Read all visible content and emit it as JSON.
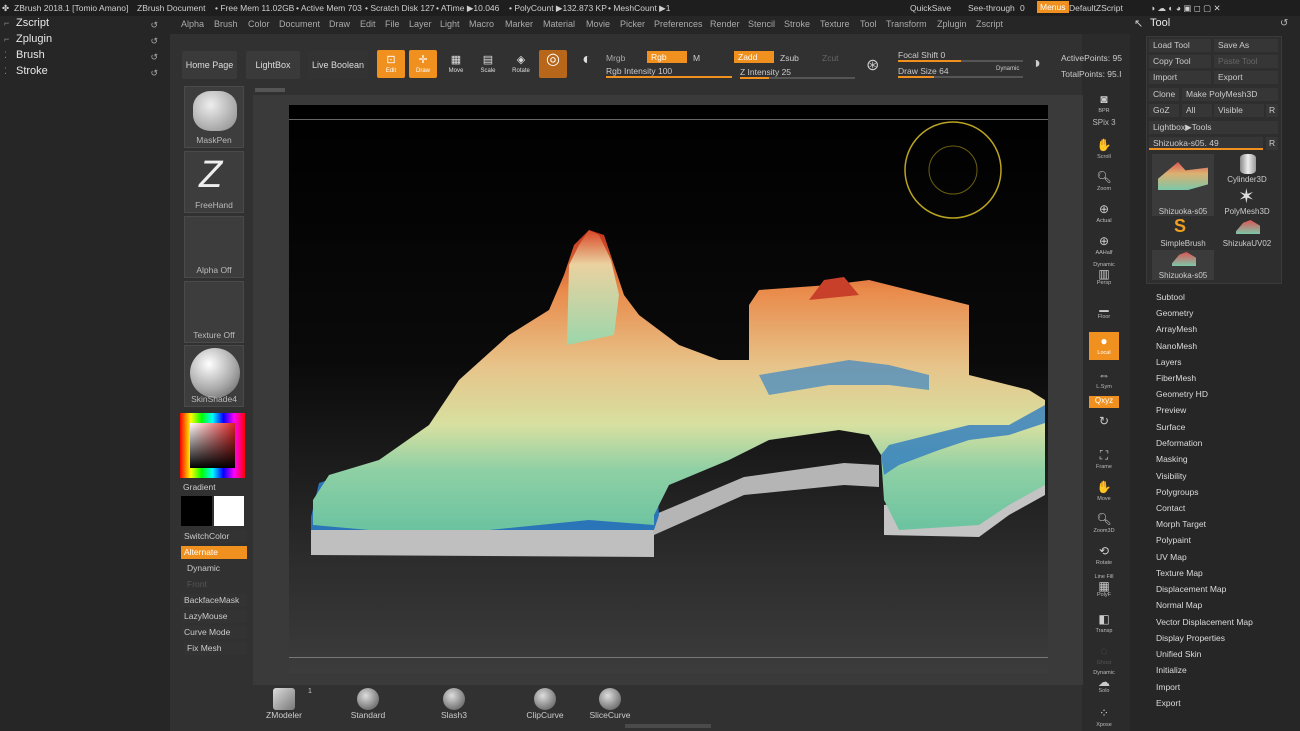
{
  "topbar": {
    "app_title": "ZBrush 2018.1 [Tomio Amano]",
    "document": "ZBrush Document",
    "free_mem": "• Free Mem 11.02GB",
    "active_mem": "• Active Mem 703",
    "scratch": "• Scratch Disk 127",
    "atime": "• ATime ▶10.046",
    "polycount": "• PolyCount ▶132.873 KP",
    "meshcount": "• MeshCount ▶1",
    "quicksave": "QuickSave",
    "see_through": "See-through",
    "see_through_val": "0",
    "menus": "Menus",
    "default_script": "DefaultZScript"
  },
  "menubar": [
    "Alpha",
    "Brush",
    "Color",
    "Document",
    "Draw",
    "Edit",
    "File",
    "Layer",
    "Light",
    "Macro",
    "Marker",
    "Material",
    "Movie",
    "Picker",
    "Preferences",
    "Render",
    "Stencil",
    "Stroke",
    "Texture",
    "Tool",
    "Transform",
    "Zplugin",
    "Zscript"
  ],
  "left_palettes": [
    "Zscript",
    "Zplugin",
    "Brush",
    "Stroke"
  ],
  "shelf": {
    "home": "Home Page",
    "lightbox": "LightBox",
    "live_boolean": "Live Boolean",
    "edit": "Edit",
    "draw": "Draw",
    "move": "Move",
    "scale": "Scale",
    "rotate": "Rotate",
    "mrgb": "Mrgb",
    "rgb": "Rgb",
    "m": "M",
    "rgb_intensity": "Rgb Intensity 100",
    "zadd": "Zadd",
    "zsub": "Zsub",
    "zcut": "Zcut",
    "z_intensity": "Z Intensity 25",
    "focal_shift": "Focal Shift 0",
    "draw_size": "Draw Size 64",
    "dynamic": "Dynamic",
    "active_points": "ActivePoints: 95",
    "total_points": "TotalPoints: 95.I"
  },
  "left_shelf": {
    "maskpen": "MaskPen",
    "freehand": "FreeHand",
    "alpha_off": "Alpha Off",
    "texture_off": "Texture Off",
    "skinshade": "SkinShade4",
    "gradient": "Gradient",
    "switch_color": "SwitchColor",
    "alternate": "Alternate",
    "dynamic": "Dynamic",
    "front": "Front",
    "backface": "BackfaceMask",
    "lazymouse": "LazyMouse",
    "curve_mode": "Curve Mode",
    "fix_mesh": "Fix Mesh"
  },
  "right_tools": {
    "bpr": "BPR",
    "spix": "SPix 3",
    "scroll": "Scroll",
    "zoom": "Zoom",
    "actual": "Actual",
    "aahalf": "AAHalf",
    "dynamic": "Dynamic",
    "persp": "Persp",
    "floor": "Floor",
    "local": "Local",
    "lsym": "L.Sym",
    "qxyz": "Qxyz",
    "frame": "Frame",
    "move": "Move",
    "zoom3d": "Zoom3D",
    "rotate": "Rotate",
    "linefill": "Line Fill",
    "polyf": "PolyF",
    "transp": "Transp",
    "ghost": "Ghost",
    "dynamic2": "Dynamic",
    "solo": "Solo",
    "xpose": "Xpose"
  },
  "tool_panel": {
    "title": "Tool",
    "load": "Load Tool",
    "save": "Save As",
    "copy": "Copy Tool",
    "paste": "Paste Tool",
    "import": "Import",
    "export": "Export",
    "clone": "Clone",
    "make_poly": "Make PolyMesh3D",
    "goz": "GoZ",
    "all": "All",
    "visible": "Visible",
    "r": "R",
    "lightbox_tools": "Lightbox▶Tools",
    "current": "Shizuoka-s05. 49",
    "thumbs": [
      "Shizuoka-s05",
      "Cylinder3D",
      "PolyMesh3D",
      "SimpleBrush",
      "ShizukaUV02",
      "Shizuoka-s05"
    ],
    "subpalettes": [
      "Subtool",
      "Geometry",
      "ArrayMesh",
      "NanoMesh",
      "Layers",
      "FiberMesh",
      "Geometry HD",
      "Preview",
      "Surface",
      "Deformation",
      "Masking",
      "Visibility",
      "Polygroups",
      "Contact",
      "Morph Target",
      "Polypaint",
      "UV Map",
      "Texture Map",
      "Displacement Map",
      "Normal Map",
      "Vector Displacement Map",
      "Display Properties",
      "Unified Skin",
      "Initialize",
      "Import",
      "Export"
    ]
  },
  "bottom_brushes": [
    "ZModeler",
    "Standard",
    "Slash3",
    "ClipCurve",
    "SliceCurve"
  ],
  "bottom_badge": "1",
  "colors": {
    "accent": "#f0901e",
    "bg": "#2b2b2b"
  }
}
